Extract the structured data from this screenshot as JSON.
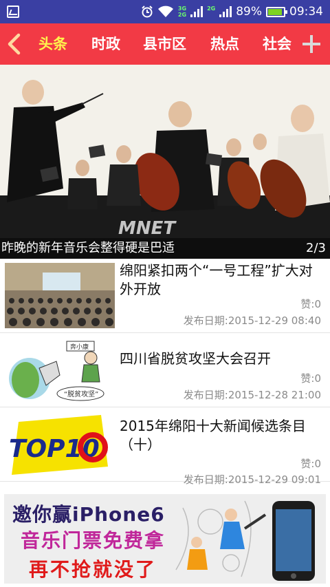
{
  "status_bar": {
    "net_top": "3G",
    "net_bottom": "2G",
    "net_top2": "2G",
    "battery": "89%",
    "time": "09:34"
  },
  "nav": {
    "tabs": [
      "头条",
      "时政",
      "县市区",
      "热点",
      "社会"
    ],
    "active_tab": "头条"
  },
  "hero": {
    "caption": "昨晚的新年音乐会整得硬是巴适",
    "counter": "2/3",
    "watermark": "MNET"
  },
  "news": [
    {
      "title": "绵阳紧扣两个“一号工程”扩大对外开放",
      "likes": "赞:0",
      "date": "发布日期:2015-12-29 08:40"
    },
    {
      "title": "四川省脱贫攻坚大会召开",
      "likes": "赞:0",
      "date": "发布日期:2015-12-28 21:00"
    },
    {
      "title": "2015年绵阳十大新闻候选条目（十）",
      "likes": "赞:0",
      "date": "发布日期:2015-12-29 09:01"
    }
  ],
  "thumb_texts": {
    "poverty_sign": "奔小康",
    "poverty_bubble": "“脱贫攻坚”",
    "top10": "TOP10"
  },
  "ad": {
    "line1": "邀你赢iPhone6",
    "line2": "音乐门票免费拿",
    "line3": "再不抢就没了"
  },
  "colors": {
    "status_bar": "#3a3fa3",
    "nav_bar": "#f23a45",
    "active_tab": "#fff34d"
  }
}
